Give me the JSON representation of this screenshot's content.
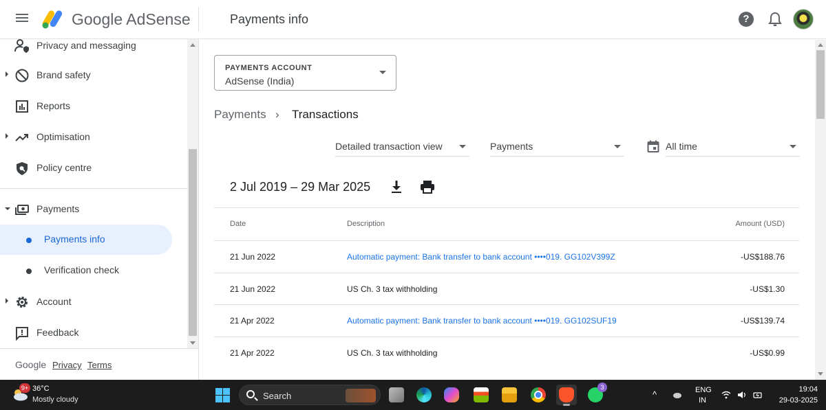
{
  "header": {
    "brand": "Google AdSense",
    "title": "Payments info"
  },
  "sidebar": {
    "items": [
      {
        "label": "Privacy and messaging",
        "icon": "person-shield-icon"
      },
      {
        "label": "Brand safety",
        "icon": "block-icon"
      },
      {
        "label": "Reports",
        "icon": "bar-chart-icon"
      },
      {
        "label": "Optimisation",
        "icon": "trending-up-icon"
      },
      {
        "label": "Policy centre",
        "icon": "policy-icon"
      },
      {
        "label": "Payments",
        "icon": "payments-icon"
      },
      {
        "label": "Payments info"
      },
      {
        "label": "Verification check"
      },
      {
        "label": "Account",
        "icon": "gear-icon"
      },
      {
        "label": "Feedback",
        "icon": "feedback-icon"
      }
    ],
    "footer": {
      "google": "Google",
      "privacy": "Privacy",
      "terms": "Terms"
    }
  },
  "main": {
    "account": {
      "label": "PAYMENTS ACCOUNT",
      "value": "AdSense (India)"
    },
    "breadcrumb": {
      "parent": "Payments",
      "sep": "›",
      "current": "Transactions"
    },
    "filters": {
      "view": "Detailed transaction view",
      "type": "Payments",
      "period": "All time"
    },
    "range": "2 Jul 2019 – 29 Mar 2025",
    "table": {
      "headers": {
        "date": "Date",
        "description": "Description",
        "amount": "Amount (USD)"
      },
      "rows": [
        {
          "date": "21 Jun 2022",
          "description": "Automatic payment: Bank transfer to bank account  ••••019. GG102V399Z",
          "amount": "-US$188.76",
          "link": true
        },
        {
          "date": "21 Jun 2022",
          "description": "US Ch. 3 tax withholding",
          "amount": "-US$1.30",
          "link": false
        },
        {
          "date": "21 Apr 2022",
          "description": "Automatic payment: Bank transfer to bank account  ••••019. GG102SUF19",
          "amount": "-US$139.74",
          "link": true
        },
        {
          "date": "21 Apr 2022",
          "description": "US Ch. 3 tax withholding",
          "amount": "-US$0.99",
          "link": false
        }
      ]
    }
  },
  "taskbar": {
    "weather": {
      "badge": "9+",
      "temp": "36°C",
      "desc": "Mostly cloudy"
    },
    "search": "Search",
    "whatsapp_badge": "3",
    "lang": {
      "top": "ENG",
      "bottom": "IN"
    },
    "clock": {
      "time": "19:04",
      "date": "29-03-2025"
    }
  },
  "colors": {
    "accent": "#1a73e8",
    "active_bg": "#e8f0fe",
    "taskbar": "#1c1c1c"
  }
}
